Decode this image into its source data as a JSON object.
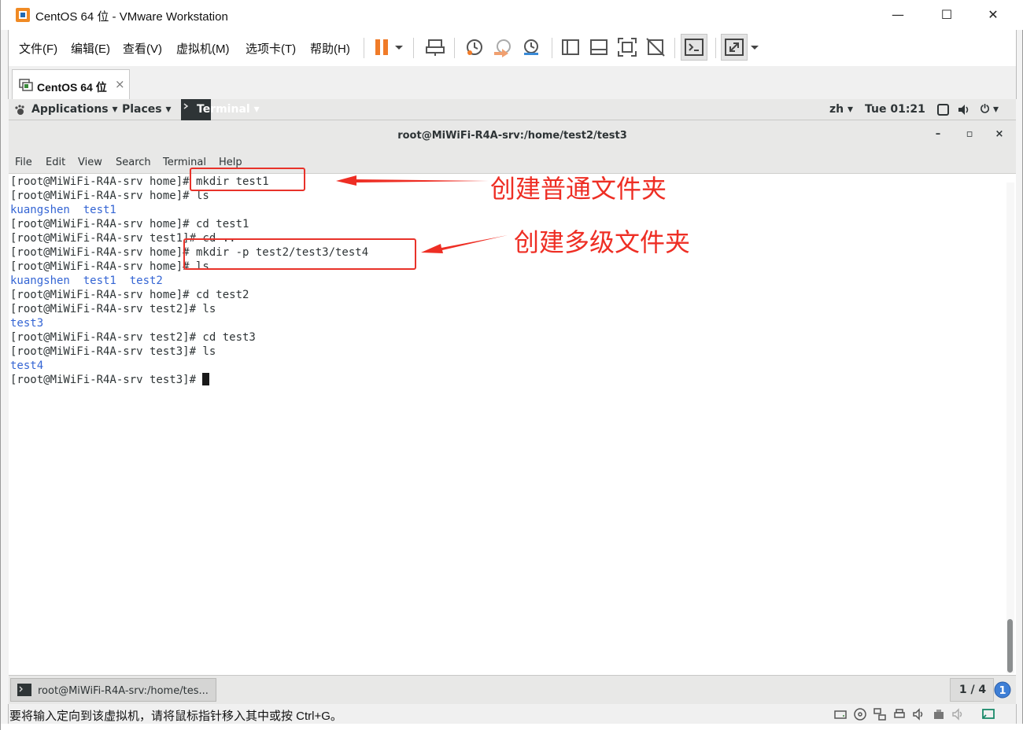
{
  "window": {
    "title": "CentOS 64 位 - VMware Workstation",
    "minimize": "—",
    "maximize": "☐",
    "close": "✕"
  },
  "menu": [
    "文件(F)",
    "编辑(E)",
    "查看(V)",
    "虚拟机(M)",
    "选项卡(T)",
    "帮助(H)"
  ],
  "tab": {
    "label": "CentOS 64 位",
    "close": "×"
  },
  "gnome": {
    "applications": "Applications ▾",
    "places": "Places ▾",
    "terminal": "Terminal ▾",
    "lang": "zh ▾",
    "clock": "Tue 01:21",
    "power": "⏻ ▾"
  },
  "terminal": {
    "title": "root@MiWiFi-R4A-srv:/home/test2/test3",
    "menu": [
      "File",
      "Edit",
      "View",
      "Search",
      "Terminal",
      "Help"
    ],
    "lines": [
      "[root@MiWiFi-R4A-srv home]# mkdir test1",
      "[root@MiWiFi-R4A-srv home]# ls",
      "kuangshen  test1",
      "[root@MiWiFi-R4A-srv home]# cd test1",
      "[root@MiWiFi-R4A-srv test1]# cd ..",
      "[root@MiWiFi-R4A-srv home]# mkdir -p test2/test3/test4",
      "[root@MiWiFi-R4A-srv home]# ls",
      "kuangshen  test1  test2",
      "[root@MiWiFi-R4A-srv home]# cd test2",
      "[root@MiWiFi-R4A-srv test2]# ls",
      "test3",
      "[root@MiWiFi-R4A-srv test2]# cd test3",
      "[root@MiWiFi-R4A-srv test3]# ls",
      "test4",
      "[root@MiWiFi-R4A-srv test3]# "
    ]
  },
  "annotations": {
    "first": "创建普通文件夹",
    "second": "创建多级文件夹"
  },
  "taskbar": {
    "task": "root@MiWiFi-R4A-srv:/home/tes...",
    "workspace": "1 / 4"
  },
  "status": {
    "text": "要将输入定向到该虚拟机，请将鼠标指针移入其中或按 Ctrl+G。"
  },
  "colors": {
    "annotation": "#ee2e24",
    "pause": "#f07b28",
    "directory": "#3465d4"
  }
}
